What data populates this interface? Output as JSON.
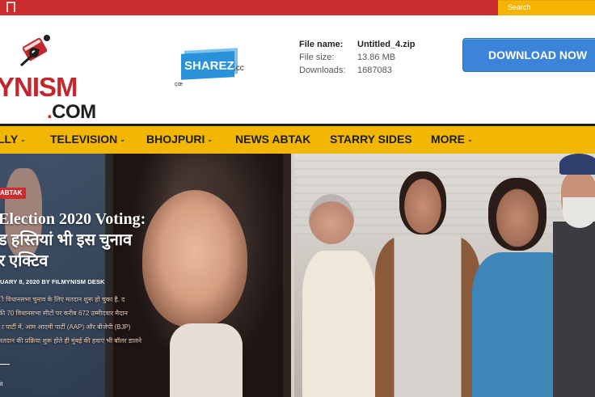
{
  "topbar": {
    "search_placeholder": "Search"
  },
  "logo": {
    "main_text": "YNISM",
    "com_text": "COM",
    "com_dot": "."
  },
  "sharez": {
    "text": "SHAREZ",
    "suffix": ".cc",
    "tiny": "çœ"
  },
  "file": {
    "rows": [
      {
        "label": "File name:",
        "value": "Untitled_4.zip"
      },
      {
        "label": "File size:",
        "value": "13.86 MB"
      },
      {
        "label": "Downloads:",
        "value": "1687083"
      }
    ]
  },
  "download_button": "DOWNLOAD NOW",
  "nav": {
    "items": [
      {
        "label": "LLY",
        "caret": true
      },
      {
        "label": "TELEVISION",
        "caret": true
      },
      {
        "label": "BHOJPURI",
        "caret": true
      },
      {
        "label": "NEWS ABTAK",
        "caret": false
      },
      {
        "label": "STARRY SIDES",
        "caret": false
      },
      {
        "label": "MORE",
        "caret": true
      }
    ],
    "caret_symbol": "⌄"
  },
  "article": {
    "category": "ABTAK",
    "headline_lines": [
      "Election 2020 Voting:",
      "ड हस्तियां भी इस चुनाव",
      "र एक्टिव"
    ],
    "meta": "UARY 8, 2020 BY FILMYNISM DESK",
    "excerpt_lines": [
      "ी विधानसभा चुनाव के लिए मतदान शुरू हो चुका है. द",
      "की 70 विधानसभा सीटों पर करीब 672 उम्मीदवार मैदान",
      "ा पार्टी में, आम आदमी पार्टी (AAP) और बीजेपी (BJP)",
      "मतदान की प्रक्रिया शुरू होते ही मुंबई की हवाएं भी बॉलर डालने"
    ],
    "read_more": "it"
  },
  "colors": {
    "topbar": "#c92d2d",
    "nav": "#f2b705",
    "download": "#3b84d9",
    "brand_red": "#c1272d"
  }
}
